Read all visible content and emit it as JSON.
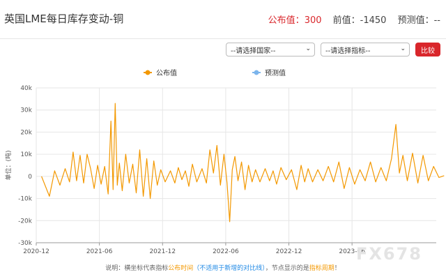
{
  "header": {
    "title": "英国LME每日库存变动-铜",
    "published_label": "公布值：",
    "published_value": "300",
    "previous_label": "前值：",
    "previous_value": "-1450",
    "forecast_label": "预测值：",
    "forecast_value": "--"
  },
  "controls": {
    "country_select": "--请选择国家--",
    "indicator_select": "--请选择指标--",
    "compare_button": "比较"
  },
  "colors": {
    "published": "#f39800",
    "forecast": "#7cb5ec",
    "accent": "#d9262b"
  },
  "note": {
    "prefix": "说明：横坐标代表指标",
    "highlight1": "公布时间",
    "paren": "（不适用于新增的对比线）",
    "middle": "，节点显示的是",
    "highlight2": "指标周期",
    "suffix": "！"
  },
  "watermark": "FX678",
  "chart_data": {
    "type": "line",
    "ylabel": "单位：(吨)",
    "ylim": [
      -30000,
      40000
    ],
    "yticks": [
      40000,
      30000,
      20000,
      10000,
      0,
      -10000,
      -20000,
      -30000
    ],
    "ytick_labels": [
      "40k",
      "30k",
      "20k",
      "10k",
      "0",
      "-10k",
      "-20k",
      "-30k"
    ],
    "xticks": [
      "2020-12",
      "2021-06",
      "2021-12",
      "2022-06",
      "2022-12",
      "2023-06"
    ],
    "xlim": [
      "2020-12",
      "2024-02"
    ],
    "grid": true,
    "legend_position": "top",
    "series": [
      {
        "name": "公布值",
        "color": "#f39800",
        "points": [
          [
            "2020-12",
            0
          ],
          [
            "2021-01",
            -9000
          ],
          [
            "2021-01",
            2500
          ],
          [
            "2021-02",
            -4000
          ],
          [
            "2021-02",
            3500
          ],
          [
            "2021-03",
            -2500
          ],
          [
            "2021-03",
            11000
          ],
          [
            "2021-03",
            -2000
          ],
          [
            "2021-04",
            9500
          ],
          [
            "2021-04",
            -3000
          ],
          [
            "2021-04",
            10000
          ],
          [
            "2021-05",
            3500
          ],
          [
            "2021-05",
            -5500
          ],
          [
            "2021-05",
            5000
          ],
          [
            "2021-06",
            -3500
          ],
          [
            "2021-06",
            4500
          ],
          [
            "2021-06",
            -8000
          ],
          [
            "2021-07",
            25000
          ],
          [
            "2021-07",
            -6000
          ],
          [
            "2021-07",
            33000
          ],
          [
            "2021-07",
            -4000
          ],
          [
            "2021-07",
            6000
          ],
          [
            "2021-08",
            -6500
          ],
          [
            "2021-08",
            10000
          ],
          [
            "2021-08",
            -3000
          ],
          [
            "2021-09",
            5500
          ],
          [
            "2021-09",
            -7500
          ],
          [
            "2021-09",
            12000
          ],
          [
            "2021-10",
            -9000
          ],
          [
            "2021-10",
            8000
          ],
          [
            "2021-10",
            -10000
          ],
          [
            "2021-11",
            7000
          ],
          [
            "2021-11",
            -4000
          ],
          [
            "2021-11",
            3000
          ],
          [
            "2021-12",
            -2500
          ],
          [
            "2021-12",
            2500
          ],
          [
            "2022-01",
            -3000
          ],
          [
            "2022-01",
            4000
          ],
          [
            "2022-01",
            -1500
          ],
          [
            "2022-02",
            2500
          ],
          [
            "2022-02",
            -4500
          ],
          [
            "2022-02",
            5500
          ],
          [
            "2022-03",
            -2500
          ],
          [
            "2022-03",
            3500
          ],
          [
            "2022-04",
            -3000
          ],
          [
            "2022-04",
            12000
          ],
          [
            "2022-04",
            1500
          ],
          [
            "2022-05",
            14000
          ],
          [
            "2022-05",
            -4000
          ],
          [
            "2022-05",
            10000
          ],
          [
            "2022-06",
            -3000
          ],
          [
            "2022-06",
            -20500
          ],
          [
            "2022-06",
            3000
          ],
          [
            "2022-06",
            9000
          ],
          [
            "2022-07",
            -2000
          ],
          [
            "2022-07",
            6500
          ],
          [
            "2022-07",
            -6000
          ],
          [
            "2022-08",
            5000
          ],
          [
            "2022-08",
            -2500
          ],
          [
            "2022-08",
            3000
          ],
          [
            "2022-09",
            -2500
          ],
          [
            "2022-09",
            3500
          ],
          [
            "2022-10",
            -2000
          ],
          [
            "2022-10",
            2500
          ],
          [
            "2022-10",
            -3500
          ],
          [
            "2022-11",
            4000
          ],
          [
            "2022-11",
            -1500
          ],
          [
            "2022-12",
            3000
          ],
          [
            "2022-12",
            -6000
          ],
          [
            "2023-01",
            5000
          ],
          [
            "2023-01",
            -2500
          ],
          [
            "2023-01",
            3500
          ],
          [
            "2023-02",
            -2500
          ],
          [
            "2023-02",
            3000
          ],
          [
            "2023-03",
            -2000
          ],
          [
            "2023-03",
            4500
          ],
          [
            "2023-04",
            -2500
          ],
          [
            "2023-04",
            6500
          ],
          [
            "2023-05",
            -5500
          ],
          [
            "2023-05",
            4000
          ],
          [
            "2023-06",
            -3500
          ],
          [
            "2023-06",
            3000
          ],
          [
            "2023-07",
            -2000
          ],
          [
            "2023-07",
            6500
          ],
          [
            "2023-08",
            -2500
          ],
          [
            "2023-08",
            4000
          ],
          [
            "2023-09",
            -2000
          ],
          [
            "2023-09",
            8000
          ],
          [
            "2023-10",
            23500
          ],
          [
            "2023-10",
            1500
          ],
          [
            "2023-10",
            9500
          ],
          [
            "2023-11",
            -2000
          ],
          [
            "2023-11",
            10500
          ],
          [
            "2023-12",
            -3000
          ],
          [
            "2023-12",
            9500
          ],
          [
            "2024-01",
            -2000
          ],
          [
            "2024-01",
            4500
          ],
          [
            "2024-02",
            -500
          ],
          [
            "2024-02",
            300
          ]
        ]
      },
      {
        "name": "预测值",
        "color": "#7cb5ec",
        "points": []
      }
    ]
  }
}
